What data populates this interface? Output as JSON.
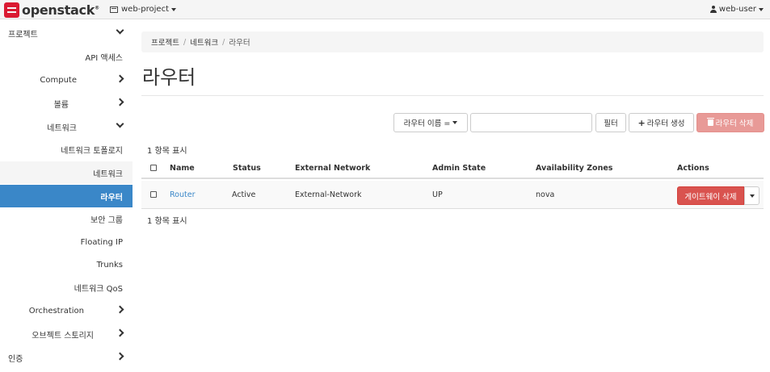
{
  "topbar": {
    "logo_text": "openstack",
    "logo_tm": "®",
    "project": "web-project",
    "user": "web-user"
  },
  "sidebar": {
    "items": [
      {
        "label": "프로젝트",
        "chevron": "down"
      },
      {
        "label": "API 액세스",
        "chevron": ""
      },
      {
        "label": "Compute",
        "chevron": "right"
      },
      {
        "label": "볼륨",
        "chevron": "right"
      },
      {
        "label": "네트워크",
        "chevron": "down"
      },
      {
        "label": "네트워크 토폴로지",
        "chevron": ""
      },
      {
        "label": "네트워크",
        "chevron": ""
      },
      {
        "label": "라우터",
        "chevron": ""
      },
      {
        "label": "보안 그룹",
        "chevron": ""
      },
      {
        "label": "Floating IP",
        "chevron": ""
      },
      {
        "label": "Trunks",
        "chevron": ""
      },
      {
        "label": "네트워크 QoS",
        "chevron": ""
      },
      {
        "label": "Orchestration",
        "chevron": "right"
      },
      {
        "label": "오브젝트 스토리지",
        "chevron": "right"
      },
      {
        "label": "인증",
        "chevron": "right"
      }
    ]
  },
  "breadcrumb": {
    "items": [
      "프로젝트",
      "네트워크",
      "라우터"
    ],
    "separator": "/"
  },
  "page": {
    "title": "라우터"
  },
  "toolbar": {
    "filter_field": "라우터 이름 =",
    "filter_value": "",
    "filter_label": "필터",
    "create_label": "라우터 생성",
    "delete_label": "라우터 삭제"
  },
  "table": {
    "count_top": "1 항목 표시",
    "count_bottom": "1 항목 표시",
    "columns": [
      "Name",
      "Status",
      "External Network",
      "Admin State",
      "Availability Zones",
      "Actions"
    ],
    "rows": [
      {
        "name": "Router",
        "status": "Active",
        "external_network": "External-Network",
        "admin_state": "UP",
        "availability_zones": "nova",
        "action_label": "게이트웨이 삭제"
      }
    ]
  },
  "colors": {
    "accent": "#3a87c8",
    "danger": "#d9534f",
    "danger_disabled": "#e89a97",
    "logo": "#da1a32"
  }
}
